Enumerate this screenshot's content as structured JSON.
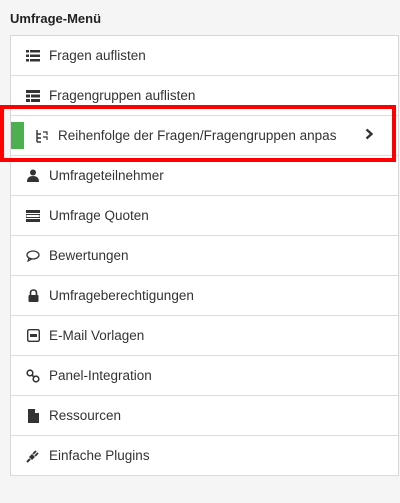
{
  "menu": {
    "title": "Umfrage-Menü",
    "items": [
      {
        "label": "Fragen auflisten",
        "icon": "list-icon"
      },
      {
        "label": "Fragengruppen auflisten",
        "icon": "list-group-icon"
      },
      {
        "label": "Reihenfolge der Fragen/Fragengruppen anpas",
        "icon": "reorder-icon",
        "active": true
      },
      {
        "label": "Umfrageteilnehmer",
        "icon": "user-icon"
      },
      {
        "label": "Umfrage Quoten",
        "icon": "quota-icon"
      },
      {
        "label": "Bewertungen",
        "icon": "comment-icon"
      },
      {
        "label": "Umfrageberechtigungen",
        "icon": "lock-icon"
      },
      {
        "label": "E-Mail Vorlagen",
        "icon": "email-template-icon"
      },
      {
        "label": "Panel-Integration",
        "icon": "link-icon"
      },
      {
        "label": "Ressourcen",
        "icon": "file-icon"
      },
      {
        "label": "Einfache Plugins",
        "icon": "plug-icon"
      }
    ]
  },
  "colors": {
    "accent": "#4caf50",
    "highlight": "#ff0000"
  }
}
